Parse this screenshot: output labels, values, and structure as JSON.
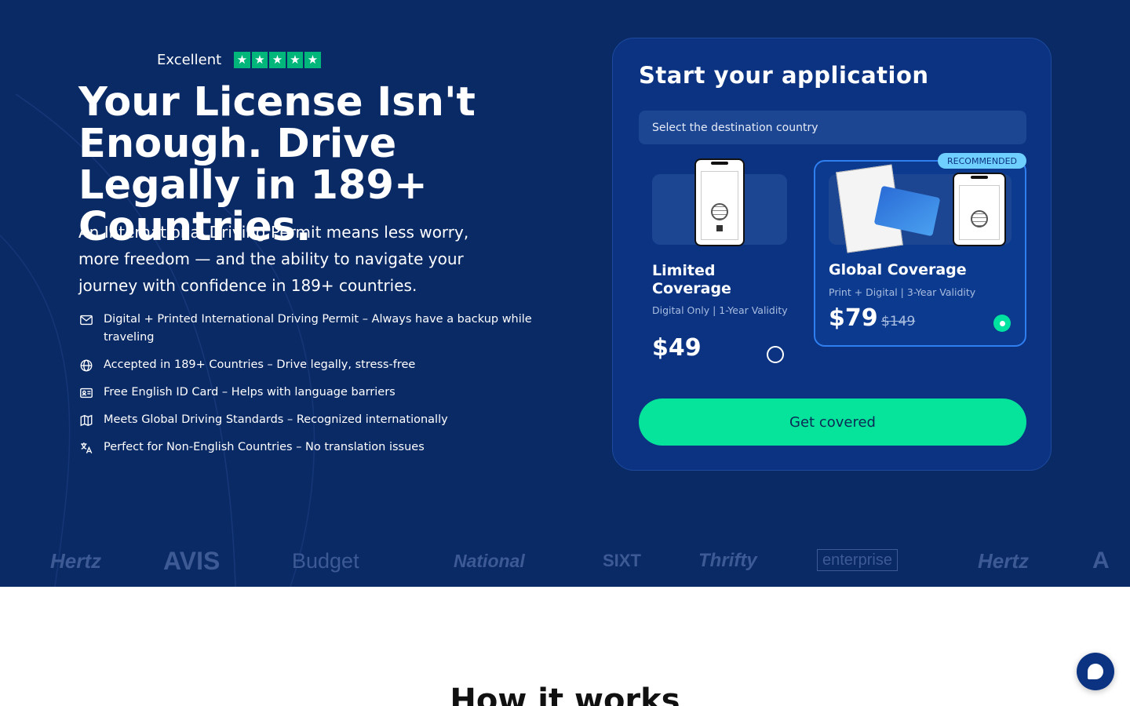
{
  "colors": {
    "hero_bg": "#0a2a66",
    "card_bg": "#0b3382",
    "accent_green": "#06e39a",
    "trustpilot_green": "#00b67a",
    "selected_border": "#2f7ff0",
    "badge_bg": "#6fd0ff"
  },
  "rating": {
    "label": "Excellent",
    "stars": 5,
    "star_icon": "star-icon"
  },
  "hero": {
    "headline": "Your License Isn't Enough. Drive Legally in 189+ Countries.",
    "subtext": "An International Driving Permit means less worry, more freedom — and the ability to navigate your journey with confidence in 189+ countries.",
    "features": [
      {
        "icon": "mail-icon",
        "text": "Digital + Printed International Driving Permit – Always have a backup while traveling"
      },
      {
        "icon": "globe-icon",
        "text": "Accepted in 189+ Countries – Drive legally, stress-free"
      },
      {
        "icon": "id-card-icon",
        "text": "Free English ID Card – Helps with language barriers"
      },
      {
        "icon": "map-icon",
        "text": "Meets Global Driving Standards – Recognized internationally"
      },
      {
        "icon": "translate-icon",
        "text": "Perfect for Non-English Countries – No translation issues"
      }
    ]
  },
  "application": {
    "title": "Start your application",
    "select_placeholder": "Select the destination country",
    "plans": [
      {
        "name": "Limited Coverage",
        "meta": "Digital Only  |  1-Year Validity",
        "price": "$49",
        "selected": false
      },
      {
        "name": "Global Coverage",
        "meta": "Print + Digital  |  3-Year Validity",
        "price": "$79",
        "old_price": "$149",
        "badge": "RECOMMENDED",
        "selected": true
      }
    ],
    "cta_label": "Get covered"
  },
  "partners": [
    "Hertz",
    "AVIS",
    "Budget",
    "National",
    "SIXT",
    "Thrifty",
    "enterprise",
    "Hertz",
    "A"
  ],
  "how_it_works": {
    "title": "How it works"
  },
  "chat": {
    "icon": "chat-icon"
  }
}
